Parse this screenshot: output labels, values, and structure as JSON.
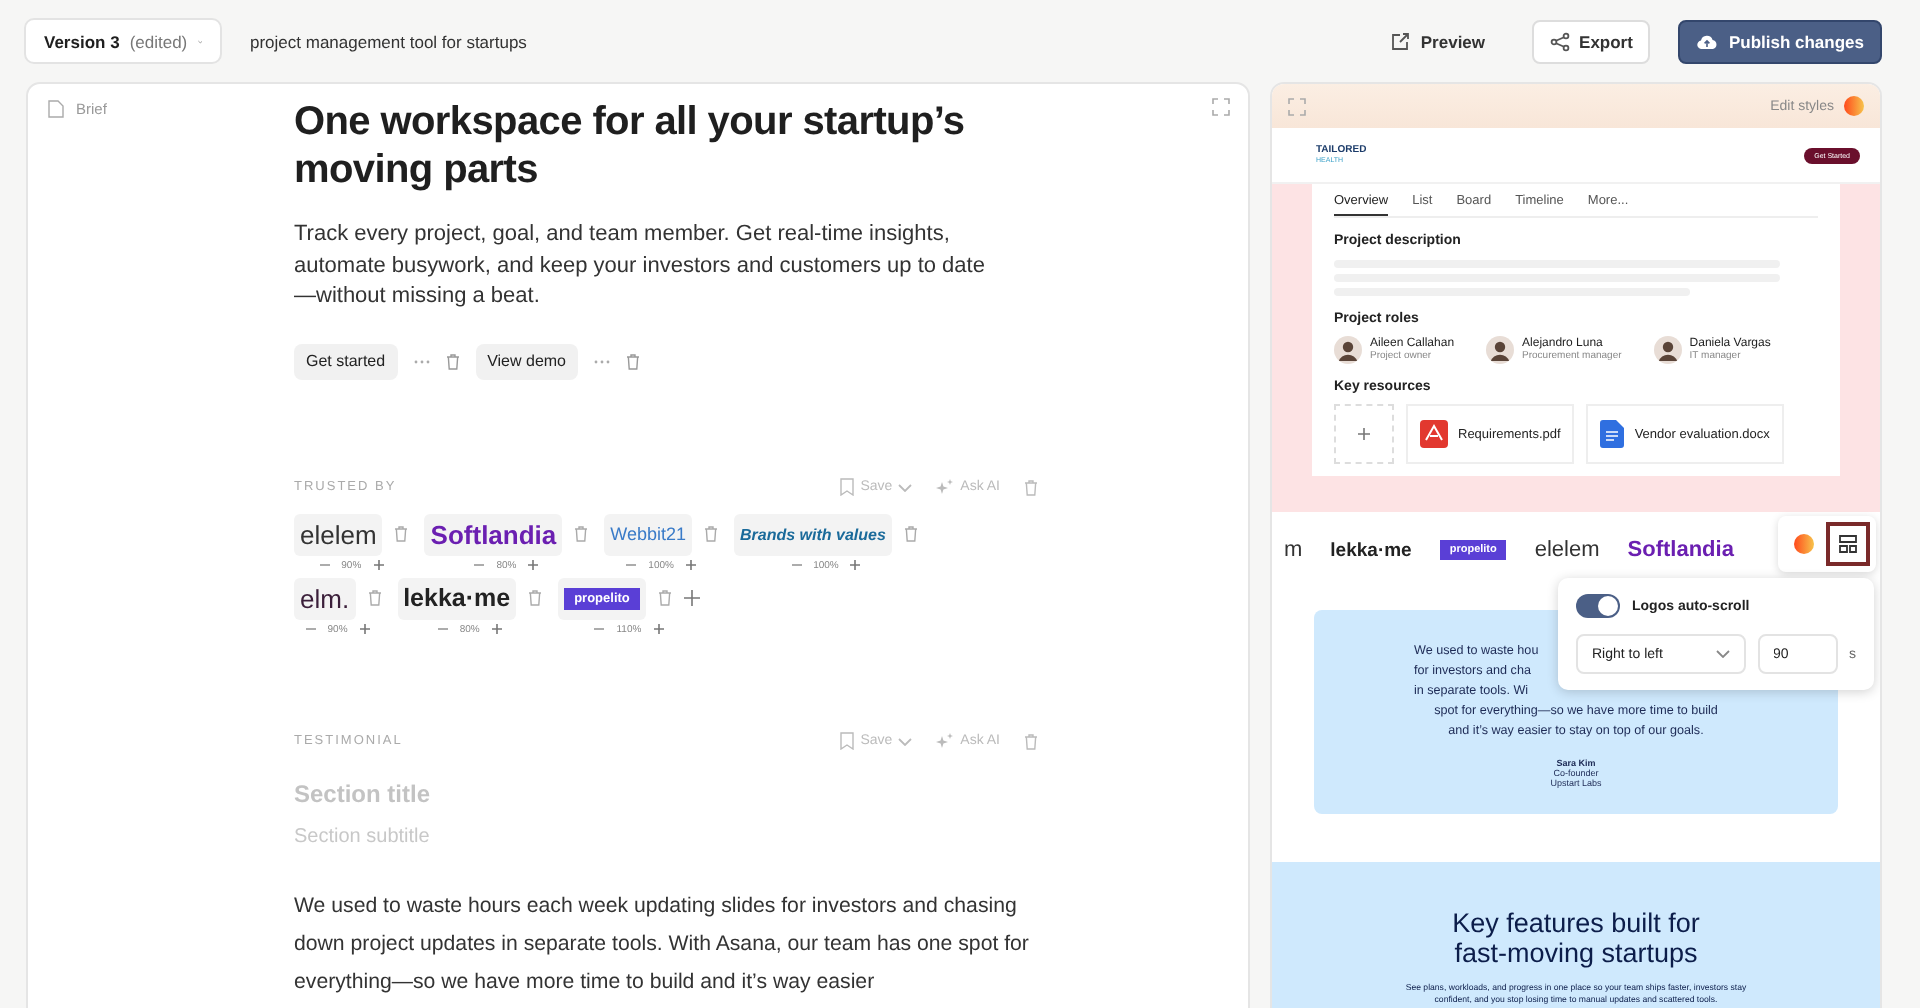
{
  "header": {
    "version": "Version 3",
    "version_note": "(edited)",
    "prompt": "project management tool for startups",
    "actions": [
      {
        "label": "Preview",
        "kind": "link"
      },
      {
        "label": "Export",
        "kind": "outline"
      },
      {
        "label": "Publish changes",
        "kind": "primary"
      }
    ]
  },
  "editor": {
    "label": "Brief",
    "hero": {
      "title": "One workspace for all your startup’s moving parts",
      "body": "Track every project, goal, and team member. Get real-time insights, automate busywork, and keep your investors and customers up to date—without missing a beat.",
      "buttons": [
        {
          "label": "Get started"
        },
        {
          "label": "View demo"
        }
      ]
    },
    "trusted": {
      "heading": "TRUSTED BY",
      "save": "Save",
      "ask_ai": "Ask AI",
      "logos": [
        {
          "text": "elelem",
          "kind": "plain",
          "scale": "90%"
        },
        {
          "text": "Softlandia",
          "kind": "purple",
          "scale": "80%"
        },
        {
          "text": "Webbit21",
          "kind": "webbit",
          "scale": "100%"
        },
        {
          "text": "Brands with values",
          "kind": "brands",
          "scale": "100%"
        },
        {
          "text": "elm.",
          "kind": "elm",
          "scale": "90%"
        },
        {
          "text": "lekka·me",
          "kind": "lekka",
          "scale": "80%"
        },
        {
          "text": "propelito",
          "kind": "propelito",
          "scale": "110%"
        }
      ]
    },
    "testimonial": {
      "heading": "TESTIMONIAL",
      "save": "Save",
      "ask_ai": "Ask AI",
      "title_placeholder": "Section title",
      "subtitle_placeholder": "Section subtitle",
      "quote": "We used to waste hours each week updating slides for investors and chasing down project updates in separate tools. With Asana, our team has one spot for everything—so we have more time to build and it’s way easier"
    }
  },
  "preview": {
    "edit_styles": "Edit styles",
    "site": {
      "logo_top": "TAILORED",
      "logo_bottom": "HEALTH",
      "cta": "Get Started",
      "tabs": [
        {
          "label": "Overview",
          "selected": true
        },
        {
          "label": "List",
          "selected": false
        },
        {
          "label": "Board",
          "selected": false
        },
        {
          "label": "Timeline",
          "selected": false
        },
        {
          "label": "More...",
          "selected": false
        }
      ],
      "description_title": "Project description",
      "roles_title": "Project roles",
      "roles": [
        {
          "name": "Aileen Callahan",
          "role": "Project owner"
        },
        {
          "name": "Alejandro Luna",
          "role": "Procurement manager"
        },
        {
          "name": "Daniela Vargas",
          "role": "IT manager"
        }
      ],
      "resources_title": "Key resources",
      "resources": [
        {
          "name": "Requirements.pdf",
          "kind": "pdf"
        },
        {
          "name": "Vendor evaluation.docx",
          "kind": "doc"
        }
      ]
    },
    "logo_strip": [
      {
        "text": "m",
        "kind": "plain"
      },
      {
        "text": "lekka·me",
        "kind": "lekka"
      },
      {
        "text": "propelito",
        "kind": "propelito"
      },
      {
        "text": "elelem",
        "kind": "plain"
      },
      {
        "text": "Softlandia",
        "kind": "purple"
      }
    ],
    "logo_toolbar": {
      "layout_selected": true
    },
    "autoscroll": {
      "label": "Logos auto-scroll",
      "on": true,
      "direction": "Right to left",
      "duration": "90",
      "unit": "s"
    },
    "quote_card": {
      "lines": [
        {
          "text": "We used to waste hou",
          "cut": true
        },
        {
          "text": "for investors and cha",
          "cut": true
        },
        {
          "text": "in separate tools. Wi",
          "cut": true
        },
        {
          "text": "spot for everything—so we have more time to build",
          "cut": false
        },
        {
          "text": "and it’s way easier to stay on top of our goals.",
          "cut": false
        }
      ],
      "name": "Sara Kim",
      "role": "Co-founder",
      "company": "Upstart Labs"
    },
    "features": {
      "title": "Key features built for fast-moving startups",
      "body": "See plans, workloads, and progress in one place so your team ships faster, investors stay confident, and you stop losing time to manual updates and scattered tools."
    }
  }
}
